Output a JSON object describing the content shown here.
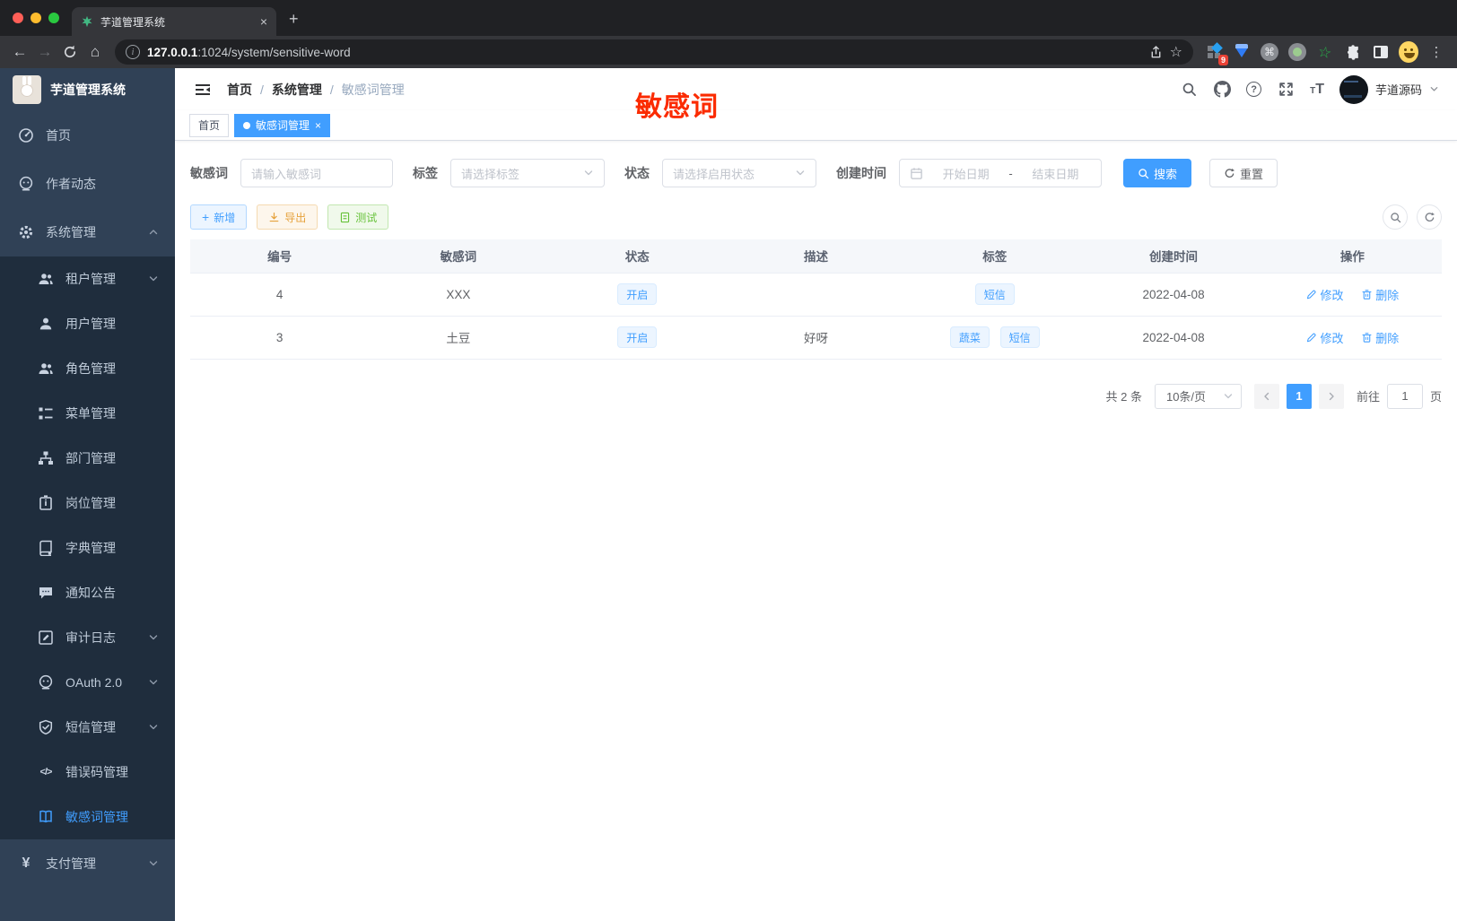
{
  "browser": {
    "tab_title": "芋道管理系统",
    "url_host": "127.0.0.1",
    "url_rest": ":1024/system/sensitive-word",
    "extension_badge": "9",
    "glyphs": {
      "back": "←",
      "forward": "→",
      "home": "⌂",
      "new_tab": "+",
      "close_tab": "×",
      "star": "☆",
      "cmd_ext": "⌘",
      "menu": "⋮",
      "info": "i"
    }
  },
  "sidebar": {
    "logo_title": "芋道管理系统",
    "items": [
      {
        "label": "首页"
      },
      {
        "label": "作者动态"
      },
      {
        "label": "系统管理"
      },
      {
        "label": "租户管理"
      },
      {
        "label": "用户管理"
      },
      {
        "label": "角色管理"
      },
      {
        "label": "菜单管理"
      },
      {
        "label": "部门管理"
      },
      {
        "label": "岗位管理"
      },
      {
        "label": "字典管理"
      },
      {
        "label": "通知公告"
      },
      {
        "label": "审计日志"
      },
      {
        "label": "OAuth 2.0"
      },
      {
        "label": "短信管理"
      },
      {
        "label": "错误码管理"
      },
      {
        "label": "敏感词管理"
      },
      {
        "label": "支付管理"
      }
    ],
    "glyphs": {
      "yen": "¥",
      "code": "</>"
    }
  },
  "header": {
    "breadcrumb": {
      "home": "首页",
      "sep": "/",
      "section": "系统管理",
      "current": "敏感词管理"
    },
    "help_glyph": "?",
    "font_icon": {
      "small": "T",
      "large": "T"
    },
    "username": "芋道源码",
    "annotation": "敏感词"
  },
  "tabs": {
    "home": "首页",
    "active": "敏感词管理",
    "close_glyph": "×"
  },
  "filters": {
    "keyword_label": "敏感词",
    "keyword_placeholder": "请输入敏感词",
    "tag_label": "标签",
    "tag_placeholder": "请选择标签",
    "status_label": "状态",
    "status_placeholder": "请选择启用状态",
    "date_label": "创建时间",
    "date_start": "开始日期",
    "date_separator": "-",
    "date_end": "结束日期",
    "search_label": "搜索",
    "reset_label": "重置"
  },
  "toolbar": {
    "add_label": "新增",
    "add_glyph": "+",
    "export_label": "导出",
    "test_label": "测试"
  },
  "table": {
    "headers": [
      "编号",
      "敏感词",
      "状态",
      "描述",
      "标签",
      "创建时间",
      "操作"
    ],
    "rows": [
      {
        "id": "4",
        "word": "XXX",
        "status": "开启",
        "desc": "",
        "tags": [
          "短信"
        ],
        "created": "2022-04-08"
      },
      {
        "id": "3",
        "word": "土豆",
        "status": "开启",
        "desc": "好呀",
        "tags": [
          "蔬菜",
          "短信"
        ],
        "created": "2022-04-08"
      }
    ],
    "actions": {
      "edit": "修改",
      "delete": "删除"
    }
  },
  "pagination": {
    "total": "共 2 条",
    "page_size": "10条/页",
    "prev_glyph": "‹",
    "next_glyph": "›",
    "current_page": "1",
    "goto_label": "前往",
    "goto_value": "1",
    "page_unit": "页"
  },
  "colors": {
    "accent": "#409eff",
    "warning": "#e6a23c",
    "success": "#67c23a",
    "annotation_red": "#fb2b00"
  }
}
